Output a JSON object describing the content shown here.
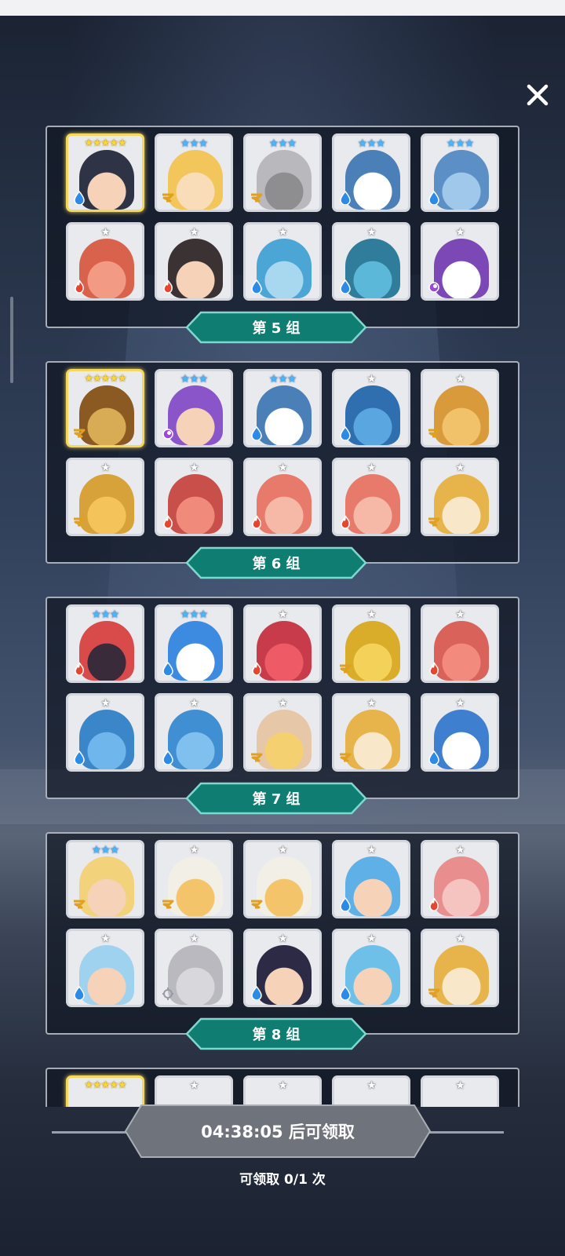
{
  "close_icon": "close-icon",
  "groups": [
    {
      "label": "第 5 组",
      "cards": [
        {
          "stars": "★★★★★",
          "tier": 5,
          "element": "water",
          "skin": "#f6d3b8",
          "hair": "#2e3345"
        },
        {
          "stars": "★★★",
          "tier": 3,
          "element": "wind",
          "skin": "#f8ddb8",
          "hair": "#f2c65a"
        },
        {
          "stars": "★★★",
          "tier": 3,
          "element": "wind",
          "skin": "#8e8e90",
          "hair": "#b9b9bd"
        },
        {
          "stars": "★★★",
          "tier": 3,
          "element": "water",
          "skin": "#ffffff",
          "hair": "#4a7fb7"
        },
        {
          "stars": "★★★",
          "tier": 3,
          "element": "water",
          "skin": "#9fc8ea",
          "hair": "#5b8fc6"
        },
        {
          "stars": "★",
          "tier": 1,
          "element": "fire",
          "skin": "#f29a83",
          "hair": "#d8624c"
        },
        {
          "stars": "★",
          "tier": 1,
          "element": "fire",
          "skin": "#f6d3b8",
          "hair": "#3b3333"
        },
        {
          "stars": "★",
          "tier": 1,
          "element": "water",
          "skin": "#a8d8ef",
          "hair": "#4ba6d6"
        },
        {
          "stars": "★",
          "tier": 1,
          "element": "water",
          "skin": "#5bb8d9",
          "hair": "#2f7d9b"
        },
        {
          "stars": "★",
          "tier": 1,
          "element": "dark",
          "skin": "#ffffff",
          "hair": "#7b48b5"
        }
      ]
    },
    {
      "label": "第 6 组",
      "cards": [
        {
          "stars": "★★★★★",
          "tier": 5,
          "element": "wind",
          "skin": "#d8ab55",
          "hair": "#8a5a22"
        },
        {
          "stars": "★★★",
          "tier": 3,
          "element": "dark",
          "skin": "#f6d3b8",
          "hair": "#8a55c9"
        },
        {
          "stars": "★★★",
          "tier": 3,
          "element": "water",
          "skin": "#ffffff",
          "hair": "#4a7fb7"
        },
        {
          "stars": "★",
          "tier": 1,
          "element": "water",
          "skin": "#5aa6e0",
          "hair": "#2f6fb0"
        },
        {
          "stars": "★",
          "tier": 1,
          "element": "wind",
          "skin": "#f1c26a",
          "hair": "#d89a3a"
        },
        {
          "stars": "★",
          "tier": 1,
          "element": "wind",
          "skin": "#f4c45a",
          "hair": "#d8a23a"
        },
        {
          "stars": "★",
          "tier": 1,
          "element": "fire",
          "skin": "#f08a7b",
          "hair": "#c94f4a"
        },
        {
          "stars": "★",
          "tier": 1,
          "element": "fire",
          "skin": "#f6b9a8",
          "hair": "#e77a6a"
        },
        {
          "stars": "★",
          "tier": 1,
          "element": "fire",
          "skin": "#f6b9a8",
          "hair": "#e77a6a"
        },
        {
          "stars": "★",
          "tier": 1,
          "element": "wind",
          "skin": "#f8e7c8",
          "hair": "#e6b44a"
        }
      ]
    },
    {
      "label": "第 7 组",
      "cards": [
        {
          "stars": "★★★",
          "tier": 3,
          "element": "fire",
          "skin": "#3a2b3b",
          "hair": "#d94b4b"
        },
        {
          "stars": "★★★",
          "tier": 3,
          "element": "water",
          "skin": "#ffffff",
          "hair": "#3d8be0"
        },
        {
          "stars": "★",
          "tier": 1,
          "element": "fire",
          "skin": "#ee5a66",
          "hair": "#c83b4a"
        },
        {
          "stars": "★",
          "tier": 1,
          "element": "wind",
          "skin": "#f4d25a",
          "hair": "#d9ad2a"
        },
        {
          "stars": "★",
          "tier": 1,
          "element": "fire",
          "skin": "#f28a7e",
          "hair": "#d9625a"
        },
        {
          "stars": "★",
          "tier": 1,
          "element": "water",
          "skin": "#6fb6ec",
          "hair": "#3b86c9"
        },
        {
          "stars": "★",
          "tier": 1,
          "element": "water",
          "skin": "#7fc0ee",
          "hair": "#3f8fd2"
        },
        {
          "stars": "★",
          "tier": 1,
          "element": "wind",
          "skin": "#f4d070",
          "hair": "#e6c7a8"
        },
        {
          "stars": "★",
          "tier": 1,
          "element": "wind",
          "skin": "#f8e7c8",
          "hair": "#e6b44a"
        },
        {
          "stars": "★",
          "tier": 1,
          "element": "water",
          "skin": "#ffffff",
          "hair": "#3f7fcf"
        }
      ]
    },
    {
      "label": "第 8 组",
      "cards": [
        {
          "stars": "★★★",
          "tier": 3,
          "element": "wind",
          "skin": "#f6d3b8",
          "hair": "#f2d27a"
        },
        {
          "stars": "★",
          "tier": 1,
          "element": "wind",
          "skin": "#f4c46a",
          "hair": "#f2efe6"
        },
        {
          "stars": "★",
          "tier": 1,
          "element": "wind",
          "skin": "#f4c46a",
          "hair": "#f2efe6"
        },
        {
          "stars": "★",
          "tier": 1,
          "element": "water",
          "skin": "#f6d3b8",
          "hair": "#5fb0e6"
        },
        {
          "stars": "★",
          "tier": 1,
          "element": "fire",
          "skin": "#f6c4c0",
          "hair": "#e88e8e"
        },
        {
          "stars": "★",
          "tier": 1,
          "element": "water",
          "skin": "#f6d3b8",
          "hair": "#9fd2ef"
        },
        {
          "stars": "★",
          "tier": 1,
          "element": "light",
          "skin": "#d8d8dc",
          "hair": "#b9b9bf"
        },
        {
          "stars": "★",
          "tier": 1,
          "element": "water",
          "skin": "#f6d3b8",
          "hair": "#2d2a45"
        },
        {
          "stars": "★",
          "tier": 1,
          "element": "water",
          "skin": "#f6d3b8",
          "hair": "#6fc0e8"
        },
        {
          "stars": "★",
          "tier": 1,
          "element": "wind",
          "skin": "#f8e7c8",
          "hair": "#e6b44a"
        }
      ]
    }
  ],
  "partial_group": {
    "cards": [
      {
        "stars": "★★★★★",
        "tier": 5
      },
      {
        "stars": "★",
        "tier": 1
      },
      {
        "stars": "★",
        "tier": 1
      },
      {
        "stars": "★",
        "tier": 1
      },
      {
        "stars": "★",
        "tier": 1
      }
    ]
  },
  "claim": {
    "button_label": "04:38:05 后可领取",
    "count_label": "可领取 0/1 次"
  },
  "colors": {
    "label_teal": "#0f7d72",
    "label_teal_edge": "#7fd8cf",
    "claim_grey": "#6f737c",
    "water": "#2c8be6",
    "fire": "#e8452f",
    "wind": "#e0a021",
    "dark": "#9b49d6",
    "light": "#9a9aa2"
  }
}
